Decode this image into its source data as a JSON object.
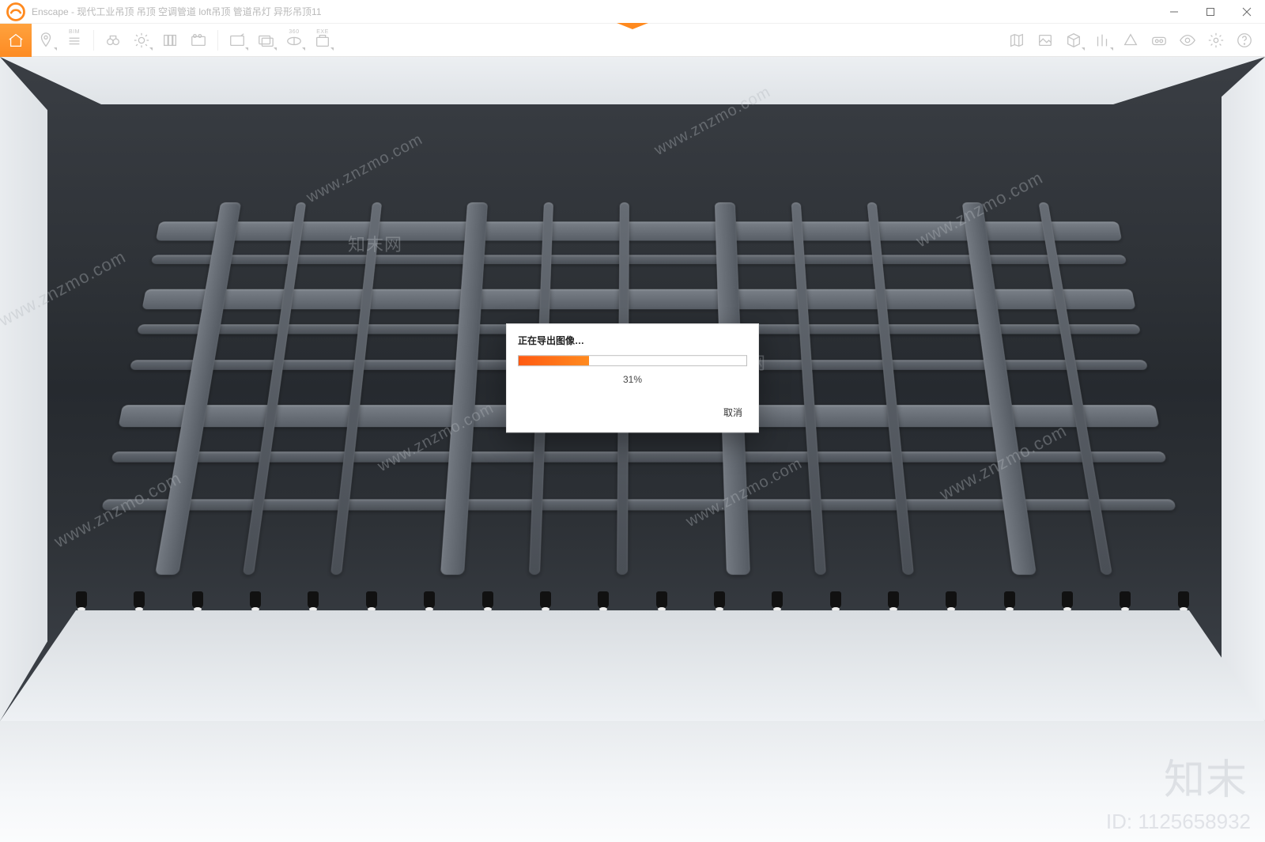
{
  "window": {
    "app_name": "Enscape",
    "title": "Enscape - 现代工业吊顶 吊顶 空调管道 loft吊顶 管道吊灯 异形吊顶11"
  },
  "titlebar_icons": {
    "minimize": "minimize",
    "maximize": "maximize",
    "close": "close"
  },
  "toolbar": {
    "left": [
      {
        "name": "home-button",
        "sup": "",
        "hint": "Home"
      },
      {
        "name": "pin-location-button",
        "sup": "",
        "hint": "Location"
      },
      {
        "name": "bim-info-button",
        "sup": "BIM",
        "hint": "BIM Info"
      },
      {
        "name": "binoculars-button",
        "sup": "",
        "hint": "Views"
      },
      {
        "name": "sun-settings-button",
        "sup": "",
        "hint": "Lighting"
      },
      {
        "name": "asset-library-button",
        "sup": "",
        "hint": "Asset Library"
      },
      {
        "name": "video-path-button",
        "sup": "",
        "hint": "Video"
      },
      {
        "name": "screenshot-button",
        "sup": "",
        "hint": "Screenshot"
      },
      {
        "name": "batch-render-button",
        "sup": "",
        "hint": "Batch Render"
      },
      {
        "name": "mono-360-button",
        "sup": "360",
        "hint": "Mono 360"
      },
      {
        "name": "exe-export-button",
        "sup": "EXE",
        "hint": "Standalone"
      }
    ],
    "right": [
      {
        "name": "map-button",
        "hint": "Map"
      },
      {
        "name": "image-overlay-button",
        "hint": "Overlay"
      },
      {
        "name": "cube-button",
        "hint": "3D"
      },
      {
        "name": "column-button",
        "hint": "Orthographic"
      },
      {
        "name": "perspective-button",
        "hint": "Perspective"
      },
      {
        "name": "vr-button",
        "hint": "VR"
      },
      {
        "name": "visibility-button",
        "hint": "Visibility"
      },
      {
        "name": "settings-button",
        "hint": "Settings"
      },
      {
        "name": "help-button",
        "hint": "Help"
      }
    ]
  },
  "dialog": {
    "title": "正在导出图像…",
    "percent_label": "31%",
    "percent_value": 31,
    "cancel_label": "取消"
  },
  "watermark": {
    "brand_cn": "知末",
    "brand_cn_small": "知末网",
    "url": "www.znzmo.com",
    "id_label": "ID: 1125658932"
  }
}
